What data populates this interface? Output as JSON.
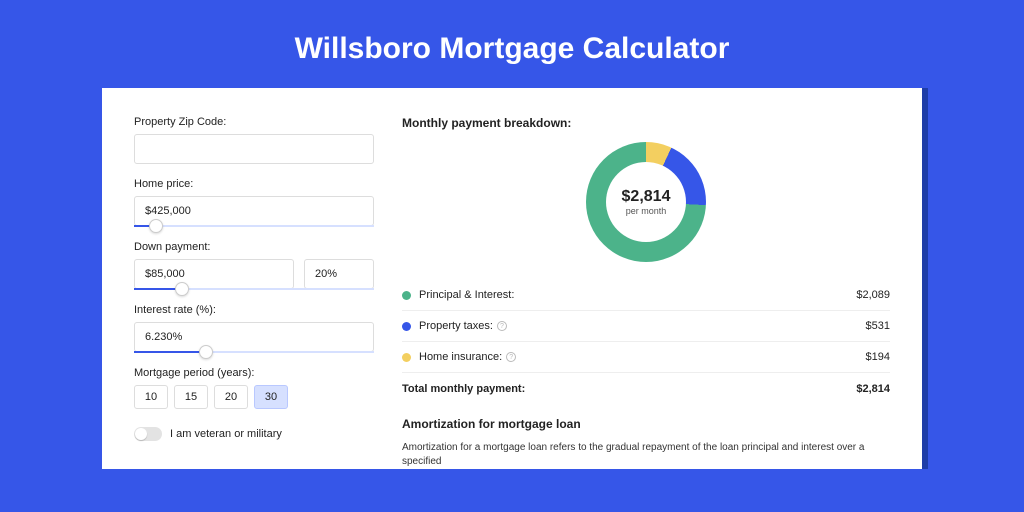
{
  "title": "Willsboro Mortgage Calculator",
  "form": {
    "zip": {
      "label": "Property Zip Code:",
      "value": ""
    },
    "price": {
      "label": "Home price:",
      "value": "$425,000",
      "slider_pct": 9
    },
    "down": {
      "label": "Down payment:",
      "amount": "$85,000",
      "pct": "20%",
      "slider_pct": 20
    },
    "rate": {
      "label": "Interest rate (%):",
      "value": "6.230%",
      "slider_pct": 30
    },
    "period": {
      "label": "Mortgage period (years):",
      "options": [
        "10",
        "15",
        "20",
        "30"
      ],
      "active": 3
    },
    "veteran": {
      "label": "I am veteran or military",
      "value": false
    }
  },
  "breakdown": {
    "title": "Monthly payment breakdown:",
    "center_value": "$2,814",
    "center_sub": "per month",
    "items": [
      {
        "label": "Principal & Interest:",
        "value": "$2,089",
        "color": "#4cb38a",
        "info": false
      },
      {
        "label": "Property taxes:",
        "value": "$531",
        "color": "#3656e8",
        "info": true
      },
      {
        "label": "Home insurance:",
        "value": "$194",
        "color": "#f3cf60",
        "info": true
      }
    ],
    "total_label": "Total monthly payment:",
    "total_value": "$2,814"
  },
  "chart_data": {
    "type": "pie",
    "title": "Monthly payment breakdown",
    "series": [
      {
        "name": "Principal & Interest",
        "value": 2089,
        "color": "#4cb38a"
      },
      {
        "name": "Property taxes",
        "value": 531,
        "color": "#3656e8"
      },
      {
        "name": "Home insurance",
        "value": 194,
        "color": "#f3cf60"
      }
    ],
    "total": 2814,
    "center_label": "$2,814 per month"
  },
  "amort": {
    "title": "Amortization for mortgage loan",
    "text": "Amortization for a mortgage loan refers to the gradual repayment of the loan principal and interest over a specified"
  }
}
